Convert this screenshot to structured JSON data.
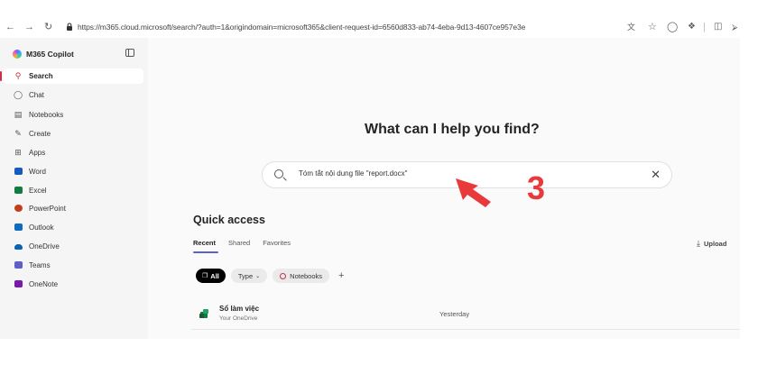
{
  "browser": {
    "url": "https://m365.cloud.microsoft/search/?auth=1&origindomain=microsoft365&client-request-id=6560d833-ab74-4eba-9d13-4607ce957e3e",
    "icons": [
      "back-icon",
      "forward-icon",
      "refresh-icon",
      "lock-icon",
      "translate-icon",
      "star-icon",
      "shield-icon",
      "extensions-icon",
      "split-view-icon",
      "collections-icon"
    ]
  },
  "sidebar": {
    "app_name": "M365 Copilot",
    "items": [
      {
        "label": "Search",
        "icon": "search-icon"
      },
      {
        "label": "Chat",
        "icon": "chat-icon"
      },
      {
        "label": "Notebooks",
        "icon": "notebook-icon"
      },
      {
        "label": "Create",
        "icon": "create-icon"
      },
      {
        "label": "Apps",
        "icon": "apps-icon"
      },
      {
        "label": "Word",
        "icon": "word-icon",
        "color": "#185abd"
      },
      {
        "label": "Excel",
        "icon": "excel-icon",
        "color": "#107c41"
      },
      {
        "label": "PowerPoint",
        "icon": "powerpoint-icon",
        "color": "#c43e1c"
      },
      {
        "label": "Outlook",
        "icon": "outlook-icon",
        "color": "#0f6cbd"
      },
      {
        "label": "OneDrive",
        "icon": "onedrive-icon",
        "color": "#0364b8"
      },
      {
        "label": "Teams",
        "icon": "teams-icon",
        "color": "#5b5fc7"
      },
      {
        "label": "OneNote",
        "icon": "onenote-icon",
        "color": "#7719aa"
      }
    ]
  },
  "main": {
    "hero_title": "What can I help you find?",
    "search": {
      "value": "Tóm tắt nội dung file \"report.docx\""
    },
    "annotation_number": "3",
    "quick_access": {
      "title": "Quick access",
      "tabs": [
        "Recent",
        "Shared",
        "Favorites"
      ],
      "upload_label": "Upload",
      "filters": {
        "all": "All",
        "type": "Type",
        "notebooks": "Notebooks"
      },
      "files": [
        {
          "name": "Sổ làm việc",
          "location": "Your OneDrive",
          "time": "Yesterday"
        }
      ]
    }
  },
  "colors": {
    "accent": "#5b5fc7",
    "active_marker": "#c4314b",
    "annotation": "#e8393b"
  }
}
